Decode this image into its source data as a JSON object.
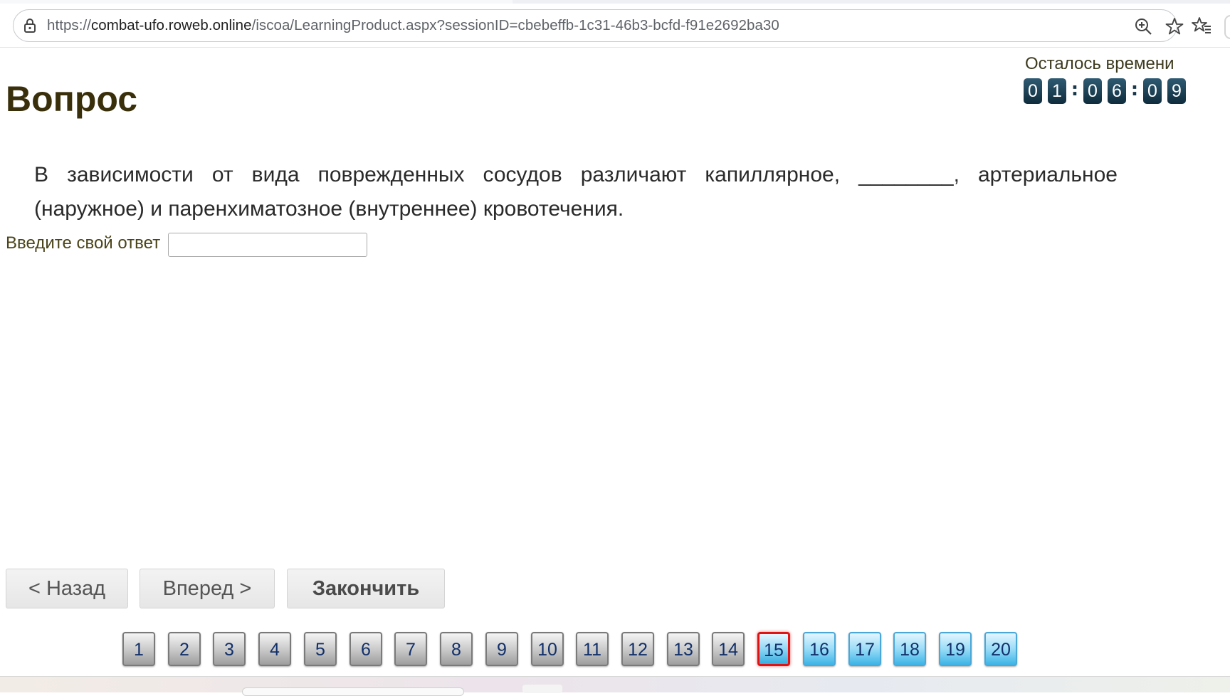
{
  "browser": {
    "url_prefix": "https://",
    "url_host": "combat-ufo.roweb.online",
    "url_path": "/iscoa/LearningProduct.aspx?sessionID=cbebeffb-1c31-46b3-bcfd-f91e2692ba30"
  },
  "timer": {
    "label": "Осталось времени",
    "digits": [
      "0",
      "1",
      "0",
      "6",
      "0",
      "9"
    ],
    "separator": ":"
  },
  "page": {
    "title": "Вопрос",
    "question": "В зависимости от вида поврежденных сосудов различают капиллярное, ________, артериальное (наружное) и паренхиматозное (внутреннее) кровотечения.",
    "answer_label": "Введите свой ответ",
    "answer_value": ""
  },
  "navigation": {
    "back_label": "< Назад",
    "next_label": "Вперед >",
    "finish_label": "Закончить"
  },
  "pager": {
    "current": "15",
    "items": [
      {
        "label": "1",
        "state": "answered"
      },
      {
        "label": "2",
        "state": "answered"
      },
      {
        "label": "3",
        "state": "answered"
      },
      {
        "label": "4",
        "state": "answered"
      },
      {
        "label": "5",
        "state": "answered"
      },
      {
        "label": "6",
        "state": "answered"
      },
      {
        "label": "7",
        "state": "answered"
      },
      {
        "label": "8",
        "state": "answered"
      },
      {
        "label": "9",
        "state": "answered"
      },
      {
        "label": "10",
        "state": "answered"
      },
      {
        "label": "11",
        "state": "answered"
      },
      {
        "label": "12",
        "state": "answered"
      },
      {
        "label": "13",
        "state": "answered"
      },
      {
        "label": "14",
        "state": "answered"
      },
      {
        "label": "15",
        "state": "current"
      },
      {
        "label": "16",
        "state": "pending"
      },
      {
        "label": "17",
        "state": "pending"
      },
      {
        "label": "18",
        "state": "pending"
      },
      {
        "label": "19",
        "state": "pending"
      },
      {
        "label": "20",
        "state": "pending"
      }
    ]
  },
  "icons": {
    "lock": "lock-icon",
    "zoom": "zoom-icon",
    "bookmark": "star-icon",
    "favorites": "favorites-icon"
  },
  "colors": {
    "title": "#3a2f0b",
    "timer_digit_bg": "#1c4256",
    "current_border": "#e01212",
    "pending_fill": "#3cb4e6"
  }
}
